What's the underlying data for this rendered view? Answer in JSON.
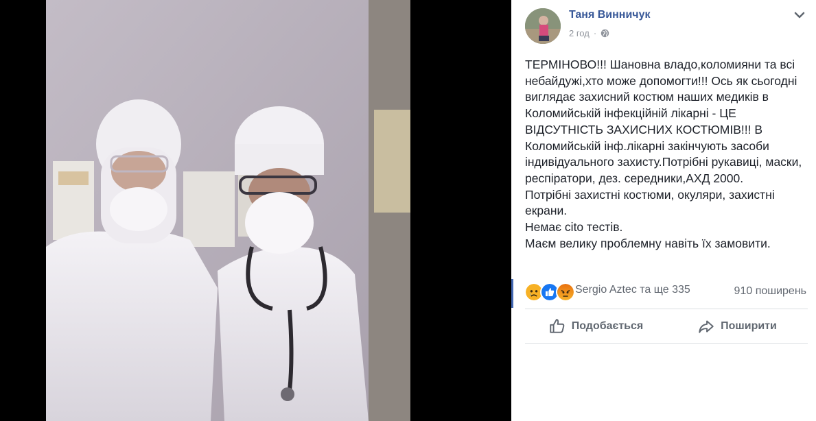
{
  "photo": {
    "icon": "photo-of-two-medics-in-white-suits"
  },
  "post": {
    "author": "Таня Винничук",
    "time": "2 год",
    "privacy_icon": "globe-icon",
    "menu_icon": "chevron-down-icon",
    "text": "ТЕРМІНОВО!!! Шановна владо,коломияни та всі\nнебайдужі,хто може допомогти!!! Ось як сьогодні\nвиглядає захисний костюм наших медиків в\nКоломийській інфекційній лікарні - ЦЕ\nВІДСУТНІСТЬ ЗАХИСНИХ КОСТЮМІВ!!! В\nКоломийській інф.лікарні закінчують засоби\nіндивідуального захисту.Потрібні рукавиці, маски,\nреспіратори, дез. середники,АХД 2000.\nПотрібні захистні костюми, окуляри, захистні\nекрани.\nНемає cito тестів.\nМаєм велику проблемну навіть їх замовити."
  },
  "reactions": {
    "icons": [
      "sad-icon",
      "like-icon",
      "angry-icon"
    ],
    "names": "Sergio Aztec та ще 335",
    "shares": "910 поширень"
  },
  "actions": {
    "like_label": "Подобається",
    "share_label": "Поширити"
  },
  "colors": {
    "link": "#385898",
    "like_blue": "#1877f2",
    "angry": "#e9710f",
    "sad": "#f7b125"
  }
}
